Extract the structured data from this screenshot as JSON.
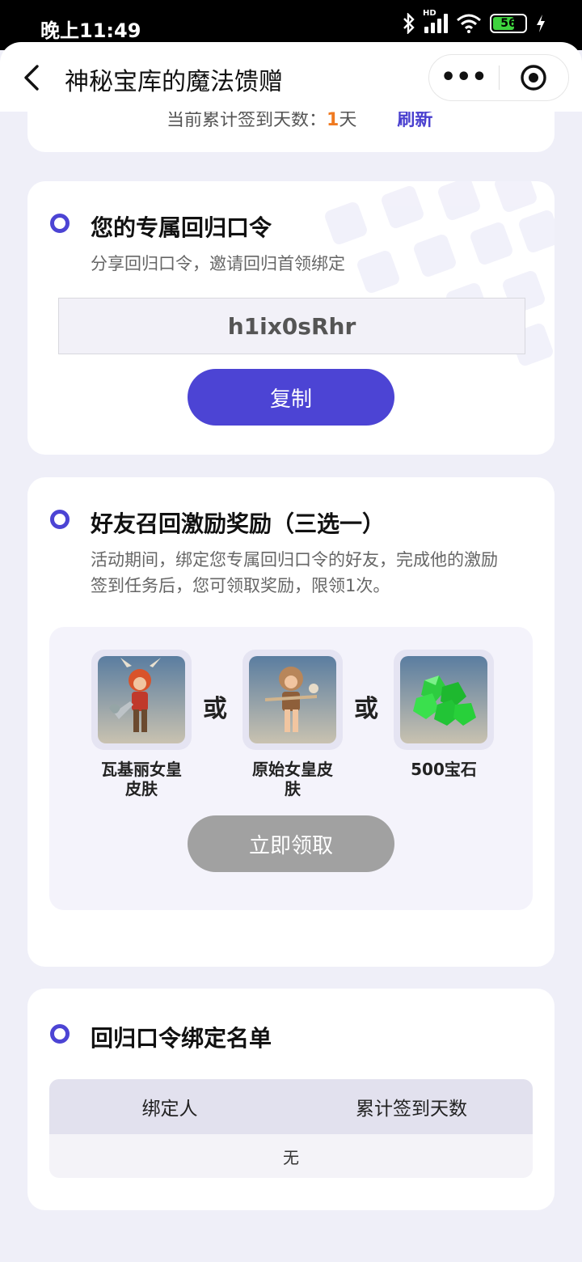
{
  "status_bar": {
    "time": "晚上11:49",
    "battery": "56",
    "icons": [
      "bluetooth-icon",
      "hd-signal-icon",
      "wifi-icon",
      "battery-icon",
      "charging-icon"
    ]
  },
  "nav": {
    "title": "神秘宝库的魔法馈赠",
    "more": "•••",
    "icons": [
      "back-icon",
      "more-icon",
      "close-target-icon"
    ]
  },
  "checkin": {
    "prefix": "当前累计签到天数：",
    "days": "1",
    "unit": "天",
    "refresh_label": "刷新"
  },
  "code_card": {
    "title": "您的专属回归口令",
    "desc": "分享回归口令，邀请回归首领绑定",
    "code": "h1ix0sRhr",
    "copy_label": "复制"
  },
  "reward_card": {
    "title": "好友召回激励奖励（三选一）",
    "desc_line1": "活动期间，绑定您专属回归口令的好友，完成他的激励",
    "desc_line2": "签到任务后，您可领取奖励，限领1次。",
    "or_label": "或",
    "items": [
      {
        "label_line1": "瓦基丽女皇",
        "label_line2": "皮肤",
        "icon": "valkyrie-queen-skin-icon"
      },
      {
        "label_line1": "原始女皇皮",
        "label_line2": "肤",
        "icon": "primal-queen-skin-icon"
      },
      {
        "label_line1": "500宝石",
        "label_line2": "",
        "icon": "gems-icon"
      }
    ],
    "claim_label": "立即领取"
  },
  "list_card": {
    "title": "回归口令绑定名单",
    "col1": "绑定人",
    "col2": "累计签到天数",
    "empty": "无"
  },
  "colors": {
    "accent": "#4c44d4",
    "disabled": "#a1a1a1",
    "orange": "#f07a20",
    "page_bg": "#efeff8"
  }
}
